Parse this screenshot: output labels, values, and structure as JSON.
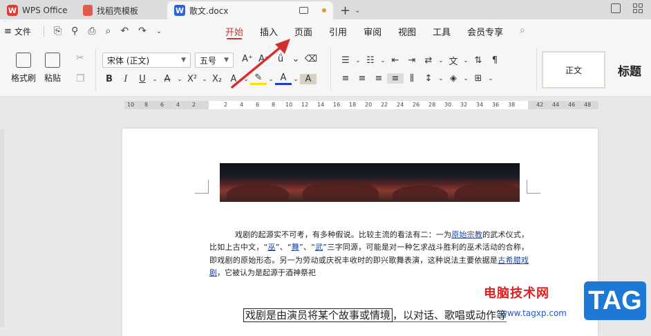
{
  "titlebar": {
    "tabs": [
      {
        "label": "WPS Office",
        "icon": "wps-logo-icon"
      },
      {
        "label": "找稻壳模板",
        "icon": "template-icon"
      },
      {
        "label": "散文.docx",
        "icon": "word-doc-icon",
        "active": true
      }
    ],
    "new_tab": "+"
  },
  "menubar": {
    "file_label": "文件",
    "tabs": [
      "开始",
      "插入",
      "页面",
      "引用",
      "审阅",
      "视图",
      "工具",
      "会员专享"
    ],
    "active_tab": "开始"
  },
  "ribbon": {
    "format_painter": "格式刷",
    "paste": "粘贴",
    "font_name": "宋体 (正文)",
    "font_size": "五号",
    "style_normal": "正文",
    "style_heading": "标题"
  },
  "ruler": {
    "left_ticks": [
      "10",
      "8",
      "6",
      "4",
      "2"
    ],
    "center_ticks": [
      "2",
      "4",
      "6",
      "8",
      "10",
      "12",
      "14",
      "16",
      "18",
      "20",
      "22",
      "24",
      "26",
      "28",
      "30",
      "32",
      "34",
      "36",
      "38"
    ],
    "right_ticks": [
      "42",
      "44",
      "46",
      "48"
    ]
  },
  "document": {
    "para_1": "戏剧的起源实不可考，有多种假说。比较主流的看法有二：一为",
    "link_1": "原始宗教",
    "para_2": "的武术仪式，比如上古中文，“",
    "link_2": "巫",
    "para_3": "”、“",
    "link_3": "舞",
    "para_4": "”、“",
    "link_4": "武",
    "para_5": "”三字同源，可能是对一种乞求战斗胜利的巫术活动的合称，即戏剧的原始形态。另一为劳动或庆祝丰收时的即兴歌舞表演，这种说法主要依据是",
    "link_5": "古希腊戏剧",
    "para_6": "，它被认为是起源于酒神祭祀",
    "big_line_boxed": "戏剧是由演员将某个故事或情境",
    "big_line_rest": "，以对话、歌唱或动作等"
  },
  "watermark": {
    "site_name": "电脑技术网",
    "url": "www.tagxp.com",
    "tag": "TAG"
  },
  "colors": {
    "accent_red": "#c0392b",
    "link_blue": "#22469c",
    "arrow_red": "#d32f2f"
  }
}
